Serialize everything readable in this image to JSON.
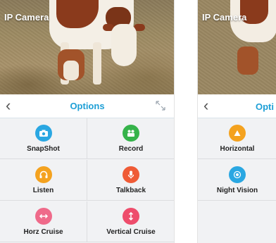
{
  "left_screen": {
    "video": {
      "overlay_title": "IP Camera"
    },
    "navbar": {
      "back_icon": "chevron-left-icon",
      "title": "Options",
      "expand_icon": "expand-arrows-icon"
    },
    "options": [
      {
        "label": "SnapShot",
        "icon": "camera-icon",
        "color": "#2aa7e2"
      },
      {
        "label": "Record",
        "icon": "video-camera-icon",
        "color": "#35b34a"
      },
      {
        "label": "Listen",
        "icon": "headphones-icon",
        "color": "#f4a21f"
      },
      {
        "label": "Talkback",
        "icon": "microphone-icon",
        "color": "#ef5b36"
      },
      {
        "label": "Horz Cruise",
        "icon": "horizontal-arrows-icon",
        "color": "#ef6a8a"
      },
      {
        "label": "Vertical Cruise",
        "icon": "vertical-arrows-icon",
        "color": "#ee4d6c"
      }
    ]
  },
  "right_screen": {
    "video": {
      "overlay_title": "IP Camera"
    },
    "navbar": {
      "back_icon": "chevron-left-icon",
      "title": "Opti"
    },
    "options": [
      {
        "label": "Horizontal",
        "icon": "triangle-icon",
        "color": "#f4a21f"
      },
      {
        "label": "Night Vision",
        "icon": "night-vision-icon",
        "color": "#2aa7e2"
      }
    ]
  }
}
